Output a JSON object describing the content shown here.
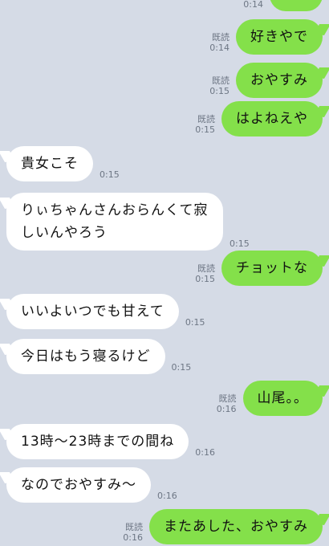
{
  "messages": [
    {
      "side": "out",
      "text": "",
      "read": "",
      "time": "0:14"
    },
    {
      "side": "out",
      "text": "好きやで",
      "read": "既読",
      "time": "0:14"
    },
    {
      "side": "out",
      "text": "おやすみ",
      "read": "既読",
      "time": "0:15"
    },
    {
      "side": "out",
      "text": "はよねえや",
      "read": "既読",
      "time": "0:15"
    },
    {
      "side": "in",
      "text": "貴女こそ",
      "time": "0:15"
    },
    {
      "side": "in",
      "text": "りぃちゃんさんおらんくて寂\nしいんやろう",
      "time": "0:15"
    },
    {
      "side": "out",
      "text": "チョットな",
      "read": "既読",
      "time": "0:15"
    },
    {
      "side": "in",
      "text": "いいよいつでも甘えて",
      "time": "0:15"
    },
    {
      "side": "in",
      "text": "今日はもう寝るけど",
      "time": "0:15"
    },
    {
      "side": "out",
      "text": "山尾。。",
      "read": "既読",
      "time": "0:16"
    },
    {
      "side": "in",
      "text": "13時〜23時までの間ね",
      "time": "0:16"
    },
    {
      "side": "in",
      "text": "なのでおやすみ〜",
      "time": "0:16"
    },
    {
      "side": "out",
      "text": "またあした、おやすみ",
      "read": "既読",
      "time": "0:16"
    }
  ]
}
